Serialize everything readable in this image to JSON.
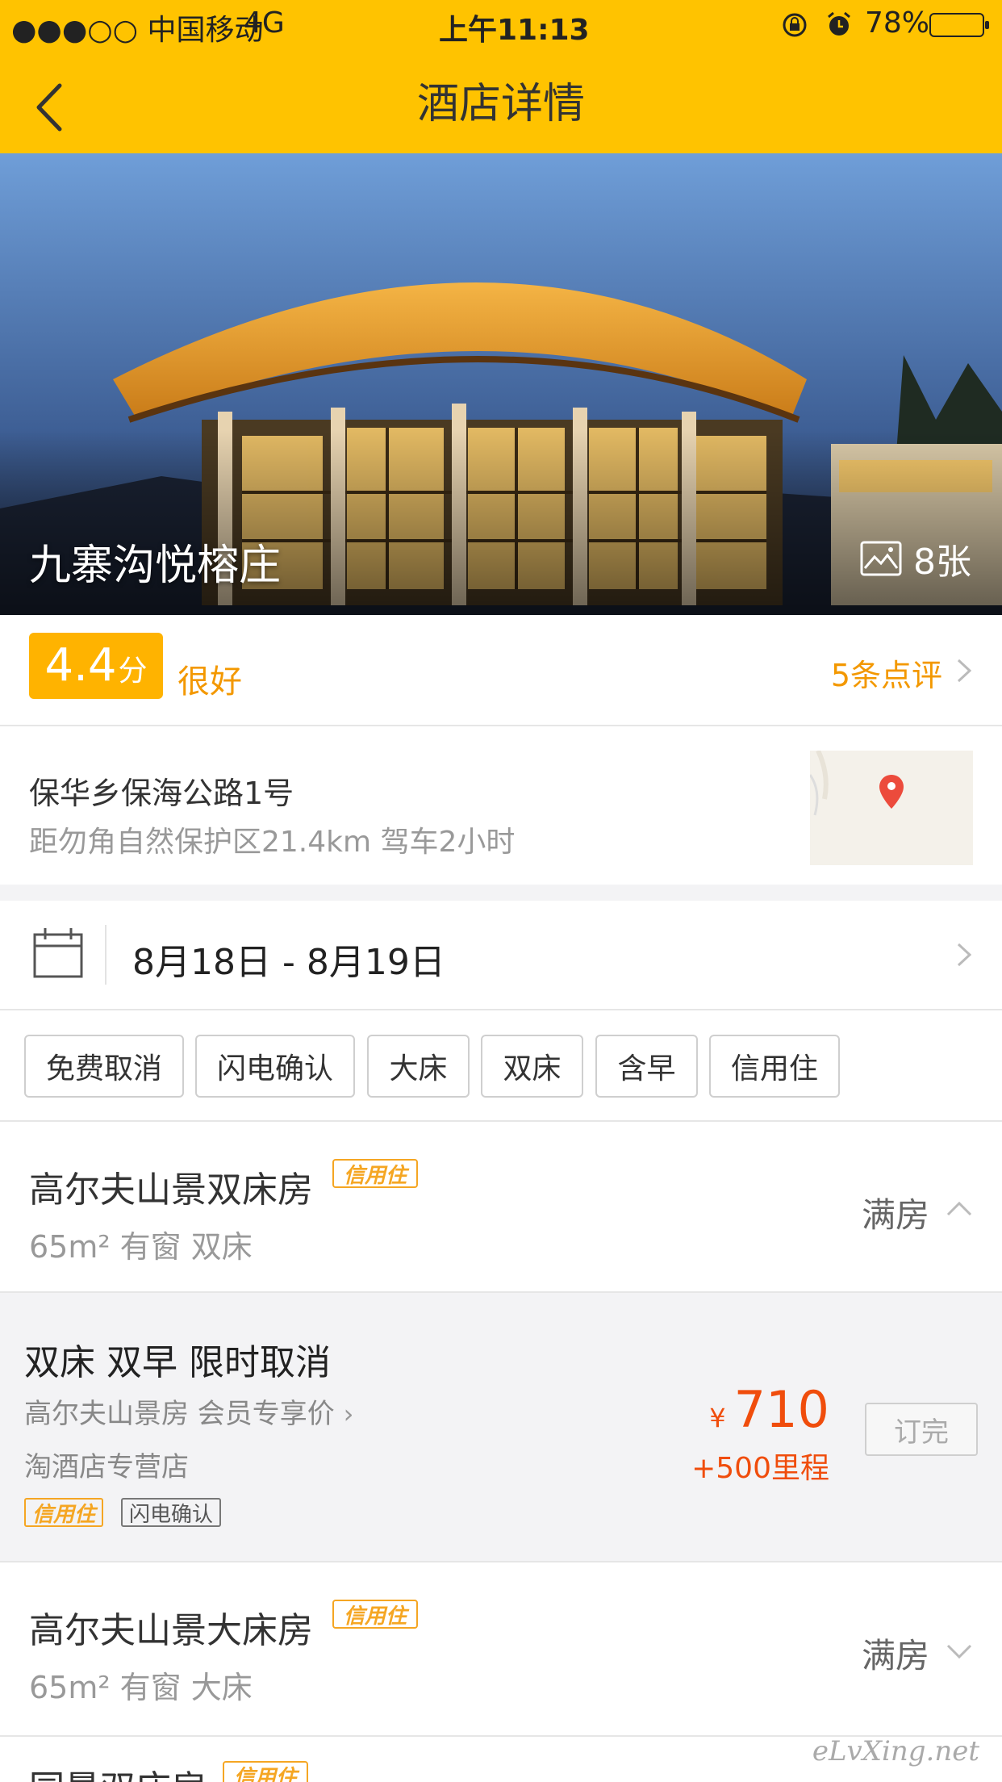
{
  "status": {
    "carrier": "●●●○○ 中国移动",
    "network": "4G",
    "time": "上午11:13",
    "battery": "78%"
  },
  "nav": {
    "title": "酒店详情"
  },
  "hotel": {
    "name": "九寨沟悦榕庄",
    "photo_count": "8张"
  },
  "rating": {
    "score": "4.4",
    "unit": "分",
    "word": "很好",
    "reviews": "5条点评"
  },
  "address": {
    "line": "保华乡保海公路1号",
    "distance": "距勿角自然保护区21.4km 驾车2小时"
  },
  "dates": {
    "range": "8月18日 - 8月19日"
  },
  "filters": [
    "免费取消",
    "闪电确认",
    "大床",
    "双床",
    "含早",
    "信用住"
  ],
  "rooms": [
    {
      "name": "高尔夫山景双床房",
      "badge": "信用住",
      "info": "65m² 有窗 双床",
      "status": "满房"
    },
    {
      "name": "高尔夫山景大床房",
      "badge": "信用住",
      "info": "65m² 有窗 大床",
      "status": "满房"
    },
    {
      "name": "园景双床房",
      "badge": "信用住"
    }
  ],
  "rate": {
    "title": "双床 双早 限时取消",
    "subtitle": "高尔夫山景房 会员专享价",
    "shop": "淘酒店专营店",
    "tag_credit": "信用住",
    "tag_flash": "闪电确认",
    "currency": "¥",
    "price": "710",
    "miles": "+500里程",
    "book_label": "订完"
  },
  "watermark": "eLvXing.net",
  "colors": {
    "brand_yellow": "#FFC300",
    "accent_orange": "#F39800",
    "price_red": "#F04D0C"
  }
}
